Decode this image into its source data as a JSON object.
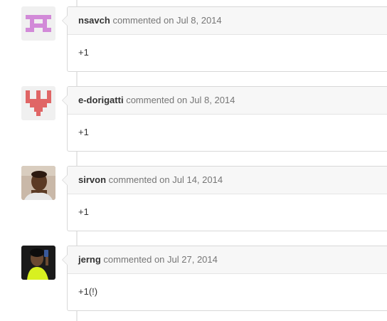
{
  "comments": [
    {
      "author": "nsavch",
      "meta": "commented on Jul 8, 2014",
      "body": "+1",
      "avatar": "identicon-purple"
    },
    {
      "author": "e-dorigatti",
      "meta": "commented on Jul 8, 2014",
      "body": "+1",
      "avatar": "identicon-red"
    },
    {
      "author": "sirvon",
      "meta": "commented on Jul 14, 2014",
      "body": "+1",
      "avatar": "user-photo"
    },
    {
      "author": "jerng",
      "meta": "commented on Jul 27, 2014",
      "body": "+1(!)",
      "avatar": "user-photo-dark"
    }
  ],
  "colors": {
    "identicon_purple": "#d28ad8",
    "identicon_red": "#e06666"
  }
}
